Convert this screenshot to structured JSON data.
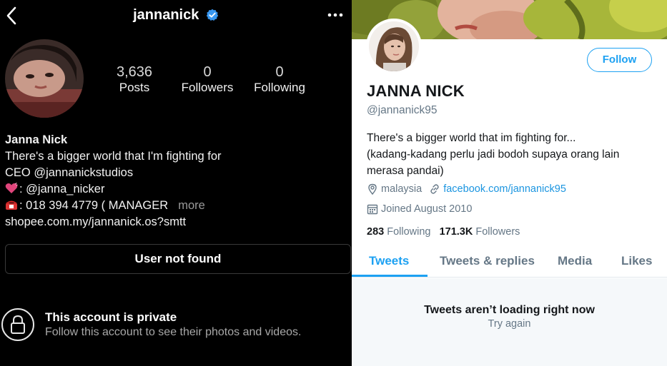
{
  "instagram": {
    "username": "jannanick",
    "stats": [
      {
        "num": "3,636",
        "label": "Posts"
      },
      {
        "num": "0",
        "label": "Followers"
      },
      {
        "num": "0",
        "label": "Following"
      }
    ],
    "bio": {
      "name": "Janna Nick",
      "line1": "There's a bigger world that I'm fighting for",
      "line2": "CEO @jannanickstudios",
      "line3": ": @janna_nicker",
      "line4": ":  018 394 4779 ( MANAGER",
      "more": "more",
      "link": "shopee.com.my/jannanick.os?smtt"
    },
    "not_found_button": "User not found",
    "private_title": "This account is private",
    "private_subtitle": "Follow this account to see their photos and videos.",
    "colors": {
      "verified": "#3897f0",
      "heart": "#e0457b",
      "phone": "#d33"
    }
  },
  "twitter": {
    "follow_label": "Follow",
    "display_name": "JANNA NICK",
    "handle": "@jannanick95",
    "bio_line1": "There's a bigger world that im fighting for...",
    "bio_line2": "(kadang-kadang perlu jadi bodoh supaya orang lain",
    "bio_line3": "merasa pandai)",
    "location": "malaysia",
    "website": "facebook.com/jannanick95",
    "joined": "Joined August 2010",
    "following_count": "283",
    "following_label": "Following",
    "followers_count": "171.3K",
    "followers_label": "Followers",
    "tabs": [
      "Tweets",
      "Tweets & replies",
      "Media",
      "Likes"
    ],
    "empty_title": "Tweets aren’t loading right now",
    "retry": "Try again",
    "colors": {
      "accent": "#1da1f2",
      "secondary_text": "#657786"
    }
  }
}
